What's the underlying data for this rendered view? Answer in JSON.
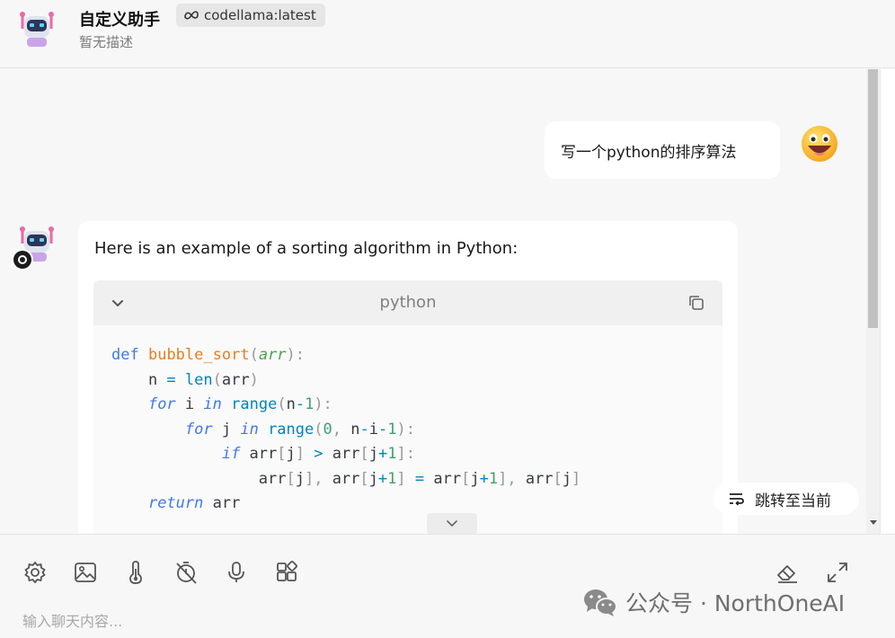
{
  "header": {
    "title": "自定义助手",
    "model_tag": "codellama:latest",
    "subtitle": "暂无描述"
  },
  "messages": {
    "user": "写一个python的排序算法",
    "assistant_text": "Here is an example of a sorting algorithm in Python:",
    "code_language": "python"
  },
  "jump_button": "跳转至当前",
  "input": {
    "placeholder": "输入聊天内容..."
  },
  "watermark": "公众号 · NorthOneAI"
}
